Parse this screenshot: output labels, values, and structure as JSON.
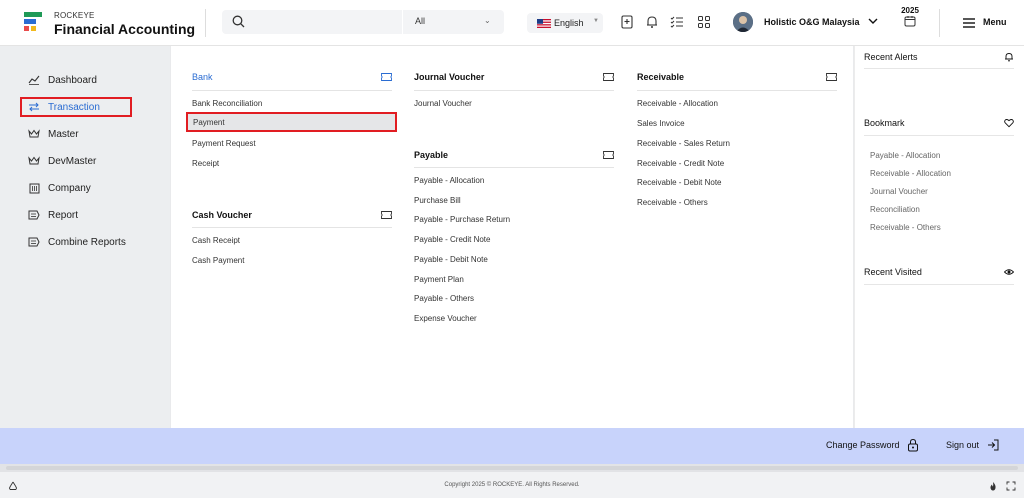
{
  "header": {
    "brand_top": "ROCKEYE",
    "brand_main": "Financial Accounting",
    "search_scope": "All",
    "language": "English",
    "company": "Holistic O&G Malaysia",
    "year": "2025",
    "menu_label": "Menu"
  },
  "sidebar": {
    "items": [
      {
        "label": "Dashboard",
        "icon": "chart-icon"
      },
      {
        "label": "Transaction",
        "icon": "swap-icon",
        "active": true
      },
      {
        "label": "Master",
        "icon": "crown-icon"
      },
      {
        "label": "DevMaster",
        "icon": "crown-icon"
      },
      {
        "label": "Company",
        "icon": "building-icon"
      },
      {
        "label": "Report",
        "icon": "report-icon"
      },
      {
        "label": "Combine Reports",
        "icon": "report-icon"
      }
    ]
  },
  "menu": {
    "bank": {
      "title": "Bank",
      "links": [
        "Bank Reconciliation",
        "Payment",
        "Payment Request",
        "Receipt"
      ]
    },
    "cash_voucher": {
      "title": "Cash Voucher",
      "links": [
        "Cash Receipt",
        "Cash Payment"
      ]
    },
    "journal_voucher": {
      "title": "Journal Voucher",
      "links": [
        "Journal Voucher"
      ]
    },
    "payable": {
      "title": "Payable",
      "links": [
        "Payable - Allocation",
        "Purchase Bill",
        "Payable - Purchase Return",
        "Payable - Credit Note",
        "Payable - Debit Note",
        "Payment Plan",
        "Payable - Others",
        "Expense Voucher"
      ]
    },
    "receivable": {
      "title": "Receivable",
      "links": [
        "Receivable - Allocation",
        "Sales Invoice",
        "Receivable - Sales Return",
        "Receivable - Credit Note",
        "Receivable - Debit Note",
        "Receivable - Others"
      ]
    }
  },
  "rightpanel": {
    "recent_alerts": "Recent Alerts",
    "bookmark": "Bookmark",
    "bookmarks": [
      "Payable - Allocation",
      "Receivable - Allocation",
      "Journal Voucher",
      "Reconciliation",
      "Receivable - Others"
    ],
    "recent_visited": "Recent Visited"
  },
  "footer": {
    "change_password": "Change Password",
    "sign_out": "Sign out",
    "copyright": "Copyright 2025 © ROCKEYE. All Rights Reserved."
  },
  "colors": {
    "accent": "#2a6cd2",
    "highlight_border": "#e11d22",
    "footer_bg": "#c8d3fb"
  }
}
